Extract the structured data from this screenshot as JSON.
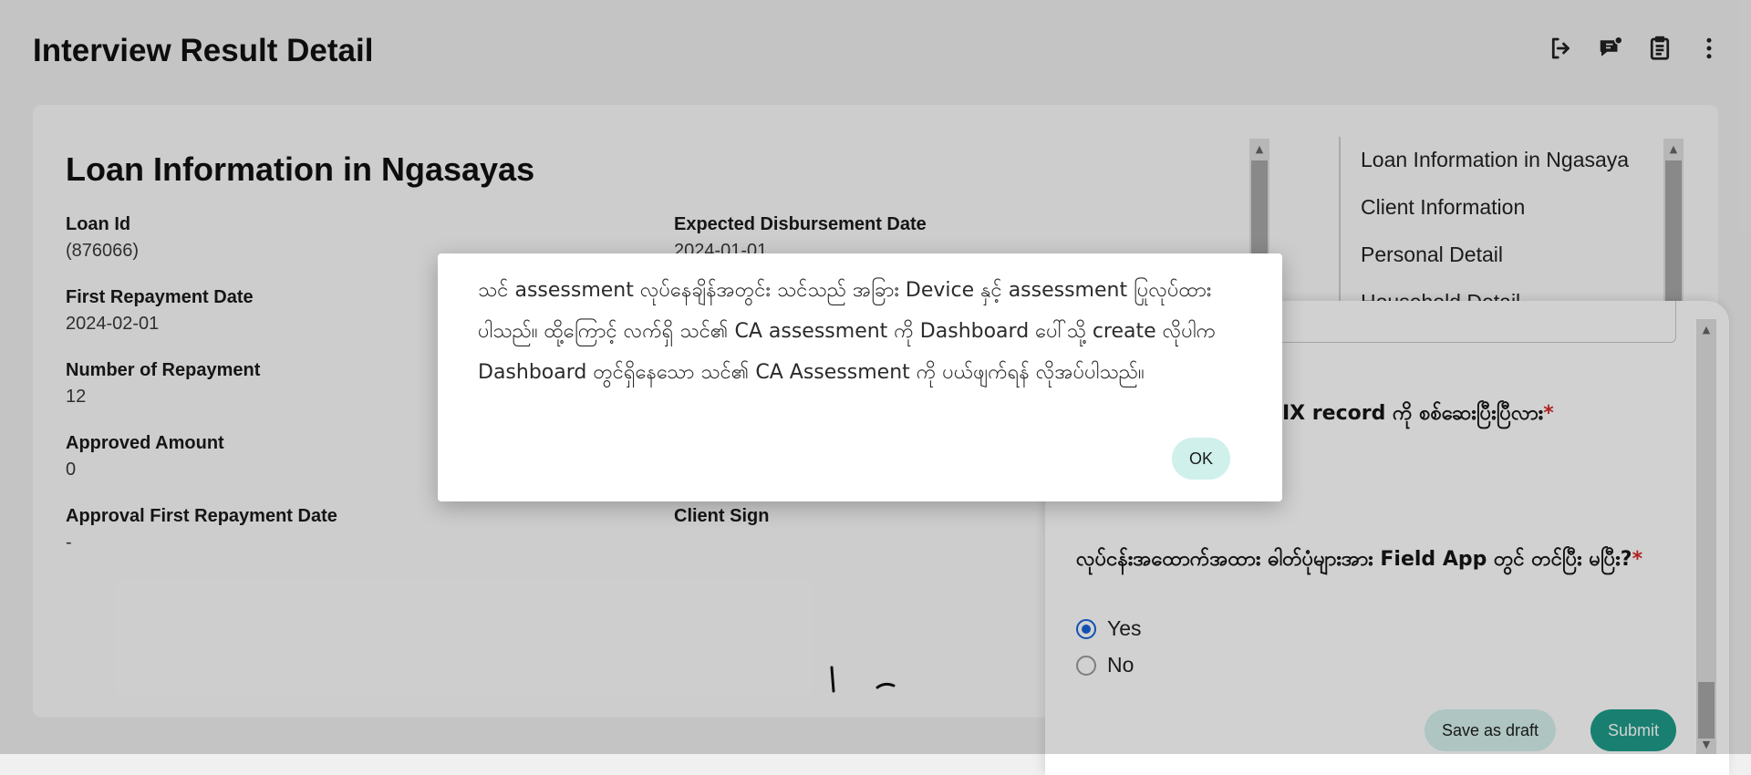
{
  "header": {
    "title": "Interview Result Detail",
    "icons": [
      "logout-icon",
      "comment-icon",
      "clipboard-icon",
      "more-vertical-icon"
    ]
  },
  "loan": {
    "title": "Loan Information in Ngasayas",
    "fields": {
      "loan_id": {
        "label": "Loan Id",
        "value": "(876066)"
      },
      "expected_disbursement": {
        "label": "Expected Disbursement Date",
        "value": "2024-01-01"
      },
      "first_repayment": {
        "label": "First Repayment Date",
        "value": "2024-02-01"
      },
      "num_repayment": {
        "label": "Number of Repayment",
        "value": "12"
      },
      "approved_amount": {
        "label": "Approved Amount",
        "value": "0"
      },
      "approval_first_repayment": {
        "label": "Approval First Repayment Date",
        "value": "-"
      },
      "client_sign": {
        "label": "Client Sign",
        "value": ""
      }
    }
  },
  "toc": {
    "items": [
      "Loan Information in Ngasaya",
      "Client Information",
      "Personal Detail",
      "Household Detail"
    ]
  },
  "form": {
    "q1_text": "IX record ကို စစ်ဆေးပြီးပြီလား",
    "q2_text": "လုပ်ငန်းအထောက်အထား ဓါတ်ပုံများအား Field App တွင် တင်ပြီး မပြီး?",
    "required_mark": "*",
    "options": {
      "yes": "Yes",
      "no": "No"
    },
    "selected": "Yes",
    "draft_label": "Save as draft",
    "submit_label": "Submit"
  },
  "dialog": {
    "message": "သင် assessment လုပ်နေချိန်အတွင်း သင်သည် အခြား Device နှင့် assessment ပြုလုပ်ထားပါသည်။ ထို့ကြောင့် လက်ရှိ သင်၏ CA assessment ကို Dashboard ပေါ်သို့ create လိုပါက Dashboard တွင်ရှိနေသော သင်၏ CA Assessment ကို ပယ်ဖျက်ရန် လိုအပ်ပါသည်။",
    "ok_label": "OK"
  },
  "colors": {
    "accent": "#1f9d8a",
    "accent_light": "#cff0eb",
    "radio_selected": "#1565d8",
    "required": "#d62c2c"
  }
}
